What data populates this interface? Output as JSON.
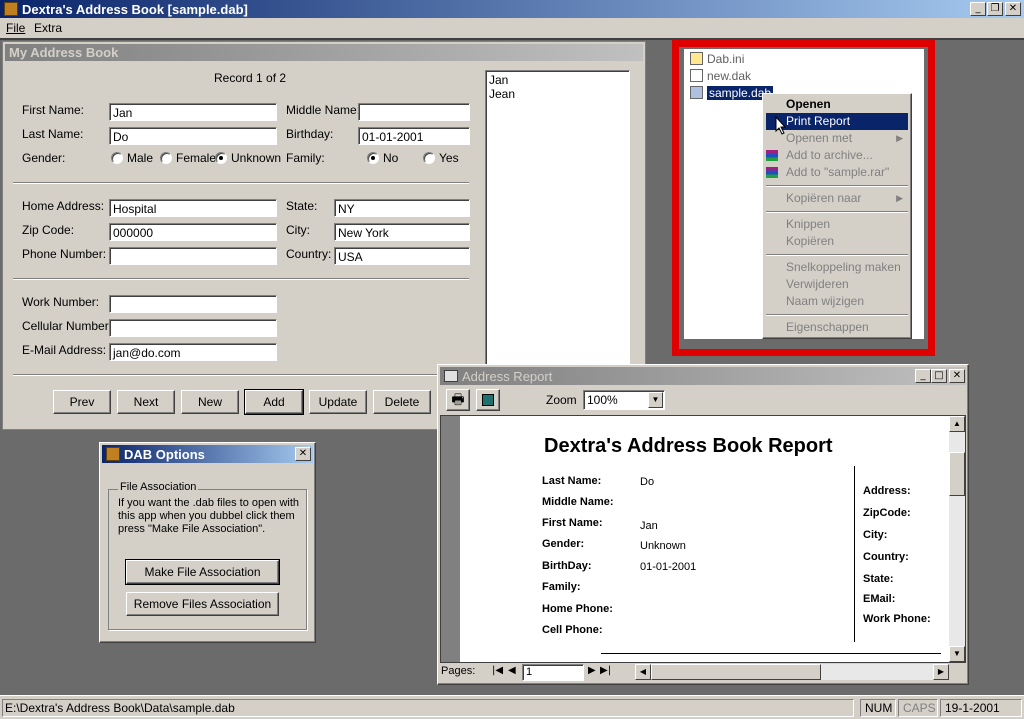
{
  "app": {
    "title": "Dextra's Address Book [sample.dab]",
    "menu": [
      "File",
      "Extra"
    ]
  },
  "address_book": {
    "title": "My Address Book",
    "record_label": "Record 1 of 2",
    "labels": {
      "first_name": "First Name:",
      "middle_name": "Middle Name:",
      "last_name": "Last Name:",
      "birthday": "Birthday:",
      "gender": "Gender:",
      "family": "Family:",
      "home_address": "Home Address:",
      "state": "State:",
      "zip_code": "Zip Code:",
      "city": "City:",
      "phone_number": "Phone Number:",
      "country": "Country:",
      "work_number": "Work Number:",
      "cellular_number": "Cellular Number:",
      "email": "E-Mail Address:"
    },
    "values": {
      "first_name": "Jan",
      "middle_name": "",
      "last_name": "Do",
      "birthday": "01-01-2001",
      "home_address": "Hospital",
      "state": "NY",
      "zip_code": "000000",
      "city": "New York",
      "phone_number": "",
      "country": "USA",
      "work_number": "",
      "cellular_number": "",
      "email": "jan@do.com"
    },
    "gender_options": {
      "male": "Male",
      "female": "Female",
      "unknown": "Unknown",
      "selected": "Unknown"
    },
    "family_options": {
      "no": "No",
      "yes": "Yes",
      "selected": "No"
    },
    "names_list": [
      "Jan",
      "Jean"
    ],
    "buttons": {
      "prev": "Prev",
      "next": "Next",
      "new": "New",
      "add": "Add",
      "update": "Update",
      "delete": "Delete"
    }
  },
  "explorer": {
    "files": [
      "Dab.ini",
      "new.dak",
      "sample.dab"
    ],
    "selected_file": "sample.dab",
    "highlight_color": "#e00000",
    "context_menu": {
      "items": [
        {
          "label": "Openen",
          "bold": true,
          "enabled": true
        },
        {
          "label": "Print Report",
          "enabled": true,
          "highlighted": true
        },
        {
          "label": "Openen met",
          "enabled": false,
          "submenu": true
        },
        {
          "label": "Add to archive...",
          "enabled": false,
          "icon": "winrar-icon"
        },
        {
          "label": "Add to \"sample.rar\"",
          "enabled": false,
          "icon": "winrar-icon"
        },
        {
          "label": "Kopiëren naar",
          "enabled": false,
          "submenu": true
        },
        {
          "label": "Knippen",
          "enabled": false
        },
        {
          "label": "Kopiëren",
          "enabled": false
        },
        {
          "label": "Snelkoppeling maken",
          "enabled": false
        },
        {
          "label": "Verwijderen",
          "enabled": false
        },
        {
          "label": "Naam wijzigen",
          "enabled": false
        },
        {
          "label": "Eigenschappen",
          "enabled": false
        }
      ]
    }
  },
  "dab_options": {
    "title": "DAB Options",
    "group_label": "File Association",
    "description": "If you want the .dab files to open with this app when you dubbel click them press \"Make File Association\".",
    "make_button": "Make File Association",
    "remove_button": "Remove Files Association"
  },
  "report": {
    "window_title": "Address Report",
    "zoom_label": "Zoom",
    "zoom_value": "100%",
    "heading": "Dextra's Address Book Report",
    "left_fields": [
      {
        "label": "Last Name:",
        "value": "Do"
      },
      {
        "label": "Middle Name:",
        "value": ""
      },
      {
        "label": "First Name:",
        "value": "Jan"
      },
      {
        "label": "Gender:",
        "value": "Unknown"
      },
      {
        "label": "BirthDay:",
        "value": "01-01-2001"
      },
      {
        "label": "Family:",
        "value": ""
      },
      {
        "label": "Home Phone:",
        "value": ""
      },
      {
        "label": "Cell Phone:",
        "value": ""
      }
    ],
    "right_fields": [
      "Address:",
      "ZipCode:",
      "City:",
      "Country:",
      "State:",
      "EMail:",
      "Work Phone:"
    ],
    "pages_label": "Pages:",
    "page_value": "1"
  },
  "statusbar": {
    "path": "E:\\Dextra's Address Book\\Data\\sample.dab",
    "num": "NUM",
    "caps": "CAPS",
    "date": "19-1-2001"
  }
}
